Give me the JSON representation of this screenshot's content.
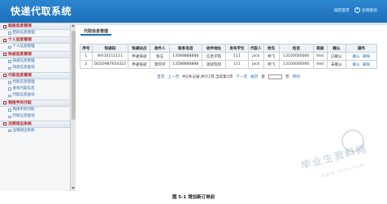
{
  "header": {
    "title": "快递代取系统",
    "home_link": "返回首页",
    "logout_link": "注销退出"
  },
  "sidebar": {
    "groups": [
      {
        "title": "超级信息管理",
        "items": [
          "密码信息管理"
        ]
      },
      {
        "title": "个人信息管理",
        "items": [
          "个人信息管理"
        ]
      },
      {
        "title": "快递信息管理",
        "items": [
          "快递信息管理",
          "快递信息查询"
        ]
      },
      {
        "title": "代取信息管理",
        "items": [
          "代取信息管理",
          "发布代取信息",
          "代取信息查询"
        ]
      },
      {
        "title": "我接手的代取",
        "items": [
          "我接手的代取",
          "代取信息查询"
        ]
      },
      {
        "title": "注销退出系统",
        "items": [
          "注销退出系统"
        ]
      }
    ]
  },
  "main": {
    "tab": "代取信息管理",
    "table": {
      "headers": [
        "序号",
        "快递码",
        "快递站点",
        "收件人",
        "联系电话",
        "收件地址",
        "发布学生",
        "代取人",
        "姓名",
        "电话",
        "班级",
        "确认",
        "操作"
      ],
      "rows": [
        [
          "1",
          "WX10111111",
          "申通快递",
          "张五",
          "13588888888",
          "信息学院",
          "111",
          "jack",
          "柯飞",
          "13100000000",
          "test",
          "已确认",
          "确认",
          "删除"
        ],
        [
          "2",
          "DD10987654322",
          "申通快递",
          "李阿学",
          "13588888888",
          "测试院校",
          "111",
          "jack",
          "柯飞",
          "13100000000",
          "test",
          "未确认",
          "确认",
          "删除"
        ]
      ]
    },
    "pager": {
      "first": "首页",
      "prev": "上一页",
      "info": "共2条记录,共计1页,当前第1页",
      "next": "下一页",
      "last": "尾页",
      "goto_prefix": "第",
      "goto_suffix": "页",
      "goto_button": "转到"
    }
  },
  "caption": "图 5-1 增加新订单前",
  "watermark": {
    "text": "毕业生资料网",
    "url": "www.sbvv.com"
  },
  "colors": {
    "header_bg": "#1d6fb8",
    "group_title": "#b22222",
    "link": "#1d6fb8"
  }
}
